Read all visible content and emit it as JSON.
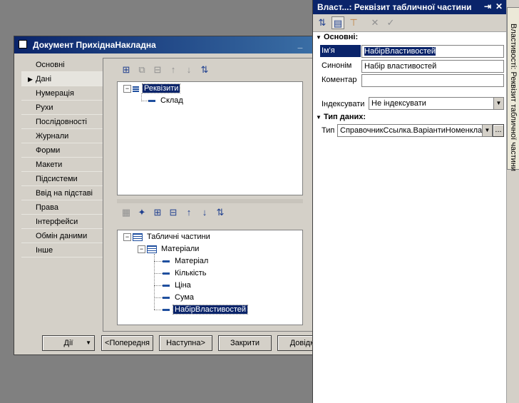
{
  "document_window": {
    "title": "Документ ПрихіднаНакладна",
    "minimize": "_",
    "nav": [
      {
        "label": "Основні"
      },
      {
        "label": "Дані",
        "selected": true
      },
      {
        "label": "Нумерація"
      },
      {
        "label": "Рухи"
      },
      {
        "label": "Послідовності"
      },
      {
        "label": "Журнали"
      },
      {
        "label": "Форми"
      },
      {
        "label": "Макети"
      },
      {
        "label": "Підсистеми"
      },
      {
        "label": "Ввід на підставі"
      },
      {
        "label": "Права"
      },
      {
        "label": "Інтерфейси"
      },
      {
        "label": "Обмін даними"
      },
      {
        "label": "Інше"
      }
    ],
    "attributes_tree": {
      "root": "Реквізити",
      "children": [
        "Склад"
      ]
    },
    "tabular_tree": {
      "root": "Табличні частини",
      "table": "Матеріали",
      "fields": [
        "Матеріал",
        "Кількість",
        "Ціна",
        "Сума",
        "НабірВластивостей"
      ]
    },
    "buttons": {
      "actions": "Дії",
      "prev": "<Попередня",
      "next": "Наступна>",
      "close": "Закрити",
      "help": "Довідка"
    }
  },
  "properties": {
    "title": "Власт...: Реквізит табличної частини",
    "pin": "⇥",
    "close": "✕",
    "section_main": "Основні:",
    "name_label": "Ім'я",
    "name_value": "НабірВластивостей",
    "synonym_label": "Синонім",
    "synonym_value": "Набір властивостей",
    "comment_label": "Коментар",
    "comment_value": "",
    "index_label": "Індексувати",
    "index_value": "Не індексувати",
    "section_type": "Тип даних:",
    "type_label": "Тип",
    "type_value": "СправочникСсылка.ВаріантиНоменклатури",
    "ellipsis": "..."
  },
  "side_tab": "Властивості: Реквізит табличної частини"
}
